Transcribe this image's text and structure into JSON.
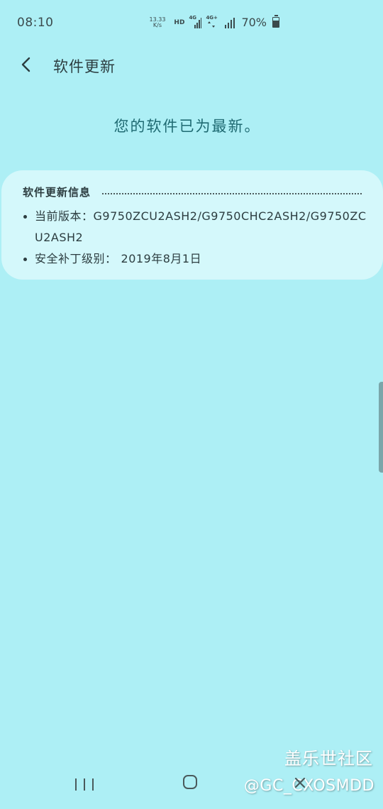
{
  "status_bar": {
    "time": "08:10",
    "net_speed_value": "13.33",
    "net_speed_unit": "K/s",
    "hd": "HD",
    "network1": "4G",
    "network2": "4G+",
    "battery_percent": "70%",
    "battery_level": 0.7,
    "icons": [
      "signal-icon",
      "signal-icon",
      "signal-icon",
      "battery-icon"
    ]
  },
  "header": {
    "back_icon": "chevron-left-icon",
    "title": "软件更新"
  },
  "status_message": "您的软件已为最新。",
  "info_card": {
    "title": "软件更新信息",
    "items": [
      {
        "label": "当前版本：",
        "value": "G9750ZCU2ASH2/G9750CHC2ASH2/G9750ZCU2ASH2"
      },
      {
        "label": "安全补丁级别：",
        "value": "2019年8月1日"
      }
    ]
  },
  "nav_bar": {
    "icons": [
      "recent-apps-icon",
      "home-icon",
      "back-icon"
    ]
  },
  "watermark": {
    "site": "盖乐世社区",
    "user": "@GC_CXOSMDD"
  },
  "colors": {
    "background": "#ADEFF5",
    "card": "#D4F8FB",
    "accent_text": "#1F6A72"
  }
}
